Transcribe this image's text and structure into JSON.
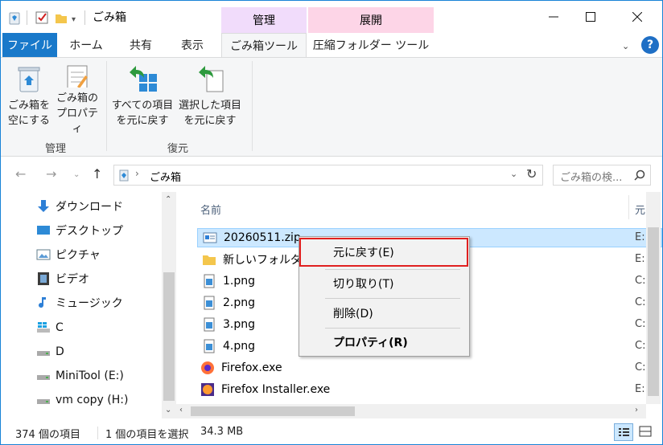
{
  "title": {
    "window_title": "ごみ箱",
    "context_group_manage": "管理",
    "context_group_extract": "展開",
    "context_manage_color": "#f1dcfb",
    "context_extract_color": "#fdd5e7"
  },
  "tabs": [
    {
      "label": "ファイル"
    },
    {
      "label": "ホーム"
    },
    {
      "label": "共有"
    },
    {
      "label": "表示"
    },
    {
      "label": "ごみ箱ツール"
    },
    {
      "label": "圧縮フォルダー ツール"
    }
  ],
  "ribbon": {
    "empty_bin_line1": "ごみ箱を",
    "empty_bin_line2": "空にする",
    "props_line1": "ごみ箱の",
    "props_line2": "プロパティ",
    "restore_all_line1": "すべての項目",
    "restore_all_line2": "を元に戻す",
    "restore_sel_line1": "選択した項目",
    "restore_sel_line2": "を元に戻す",
    "group_manage": "管理",
    "group_restore": "復元"
  },
  "address": {
    "path": "ごみ箱",
    "search_placeholder": "ごみ箱の検..."
  },
  "nav": [
    {
      "label": "ダウンロード",
      "icon": "download-arrow-icon"
    },
    {
      "label": "デスクトップ",
      "icon": "desktop-icon"
    },
    {
      "label": "ピクチャ",
      "icon": "pictures-icon"
    },
    {
      "label": "ビデオ",
      "icon": "video-icon"
    },
    {
      "label": "ミュージック",
      "icon": "music-note-icon"
    },
    {
      "label": "C",
      "icon": "windows-drive-icon"
    },
    {
      "label": "D",
      "icon": "drive-icon"
    },
    {
      "label": "MiniTool (E:)",
      "icon": "drive-icon"
    },
    {
      "label": "vm copy (H:)",
      "icon": "drive-icon"
    }
  ],
  "columns": {
    "name": "名前",
    "original": "元"
  },
  "files": [
    {
      "name": "20260511.zip",
      "loc": "E:"
    },
    {
      "name": "新しいフォルダー",
      "loc": "E:"
    },
    {
      "name": "1.png",
      "loc": "C:"
    },
    {
      "name": "2.png",
      "loc": "C:"
    },
    {
      "name": "3.png",
      "loc": "C:"
    },
    {
      "name": "4.png",
      "loc": "C:"
    },
    {
      "name": "Firefox.exe",
      "loc": "C:"
    },
    {
      "name": "Firefox Installer.exe",
      "loc": "E:"
    }
  ],
  "context_menu": {
    "restore": "元に戻す(E)",
    "cut": "切り取り(T)",
    "delete": "削除(D)",
    "properties": "プロパティ(R)"
  },
  "status": {
    "count": "374 個の項目",
    "selected": "1 個の項目を選択",
    "size": "34.3 MB"
  }
}
